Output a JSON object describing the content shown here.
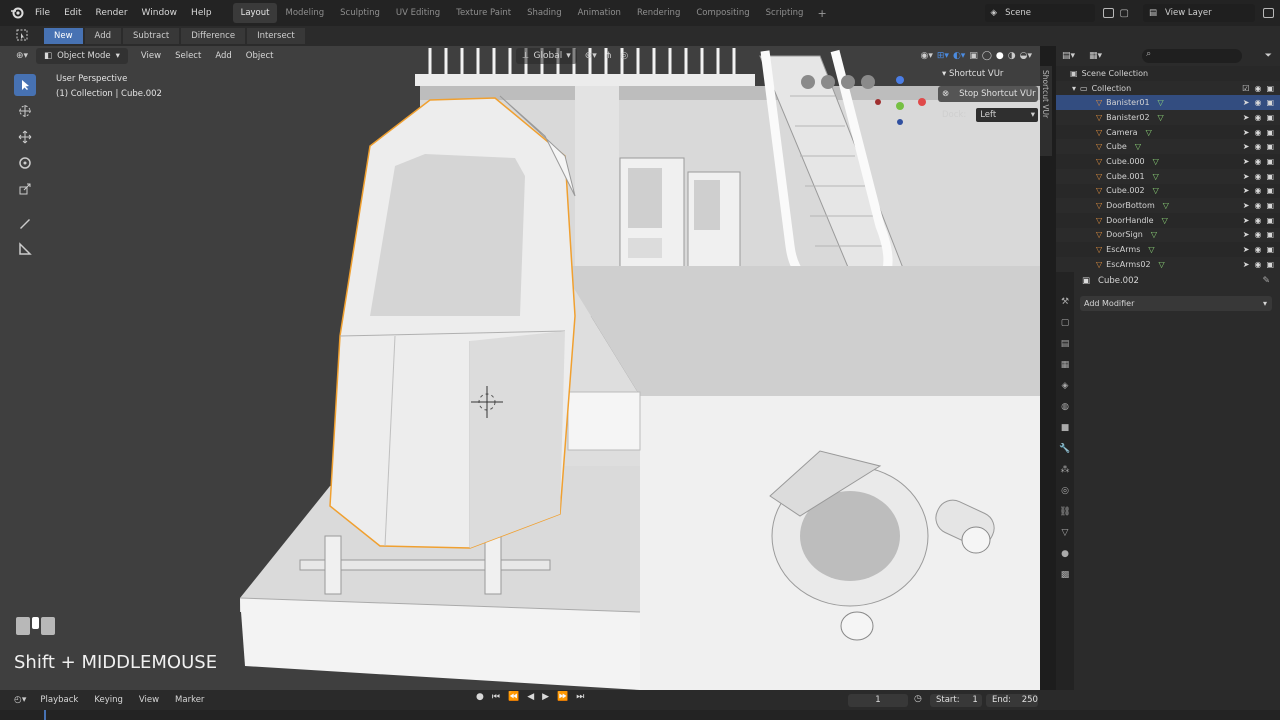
{
  "menu": {
    "items": [
      "File",
      "Edit",
      "Render",
      "Window",
      "Help"
    ]
  },
  "workspaces": {
    "tabs": [
      "Layout",
      "Modeling",
      "Sculpting",
      "UV Editing",
      "Texture Paint",
      "Shading",
      "Animation",
      "Rendering",
      "Compositing",
      "Scripting"
    ],
    "active": "Layout"
  },
  "scene": {
    "name": "Scene"
  },
  "view_layer": {
    "name": "View Layer"
  },
  "boolean_tools": {
    "buttons": [
      "New",
      "Add",
      "Subtract",
      "Difference",
      "Intersect"
    ],
    "active": "New"
  },
  "viewport": {
    "mode": "Object Mode",
    "menus": [
      "View",
      "Select",
      "Add",
      "Object"
    ],
    "transform_orientation": "Global",
    "info_line1": "User Perspective",
    "info_line2": "(1) Collection | Cube.002"
  },
  "shortcut_panel": {
    "title": "Shortcut VUr",
    "stop_label": "Stop Shortcut VUr",
    "dock_label": "Dock:",
    "dock_value": "Left"
  },
  "side_tab": {
    "label": "Shortcut VUr"
  },
  "keycast": {
    "text": "Shift + MIDDLEMOUSE"
  },
  "outliner": {
    "root": "Scene Collection",
    "collection": "Collection",
    "items": [
      {
        "name": "Banister01",
        "selected": true
      },
      {
        "name": "Banister02",
        "selected": false
      },
      {
        "name": "Camera",
        "selected": false
      },
      {
        "name": "Cube",
        "selected": false
      },
      {
        "name": "Cube.000",
        "selected": false
      },
      {
        "name": "Cube.001",
        "selected": false
      },
      {
        "name": "Cube.002",
        "selected": false
      },
      {
        "name": "DoorBottom",
        "selected": false
      },
      {
        "name": "DoorHandle",
        "selected": false
      },
      {
        "name": "DoorSign",
        "selected": false
      },
      {
        "name": "EscArms",
        "selected": false
      },
      {
        "name": "EscArms02",
        "selected": false
      }
    ]
  },
  "properties": {
    "object_name": "Cube.002",
    "add_modifier": "Add Modifier"
  },
  "timeline": {
    "menus": [
      "Playback",
      "Keying",
      "View",
      "Marker"
    ],
    "current_frame": "1",
    "start_label": "Start:",
    "start": "1",
    "end_label": "End:",
    "end": "250"
  },
  "colors": {
    "accent": "#4772b3",
    "selection_outline": "#f0a030",
    "viewport_bg": "#3f3f3f"
  }
}
